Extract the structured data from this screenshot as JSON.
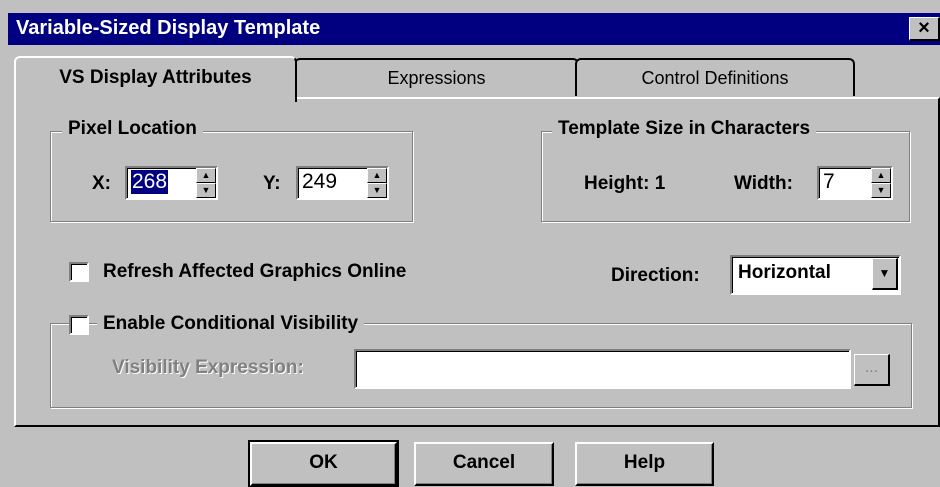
{
  "window": {
    "title": "Variable-Sized Display Template",
    "close_label": "×"
  },
  "tabs": [
    {
      "label": "VS Display Attributes",
      "active": true
    },
    {
      "label": "Expressions",
      "active": false
    },
    {
      "label": "Control Definitions",
      "active": false
    }
  ],
  "pixel_location": {
    "title": "Pixel Location",
    "x_label": "X:",
    "x_value": "268",
    "y_label": "Y:",
    "y_value": "249"
  },
  "template_size": {
    "title": "Template Size in Characters",
    "height_label": "Height: 1",
    "width_label": "Width:",
    "width_value": "7"
  },
  "refresh": {
    "label": "Refresh Affected Graphics Online",
    "checked": false
  },
  "direction": {
    "label": "Direction:",
    "value": "Horizontal"
  },
  "visibility": {
    "checkbox_label": "Enable Conditional Visibility",
    "checked": false,
    "expression_label": "Visibility Expression:",
    "expression_value": "",
    "browse_label": "..."
  },
  "buttons": {
    "ok": "OK",
    "cancel": "Cancel",
    "help": "Help"
  },
  "spin_up": "▲",
  "spin_down": "▼",
  "dropdown_arrow": "▼"
}
